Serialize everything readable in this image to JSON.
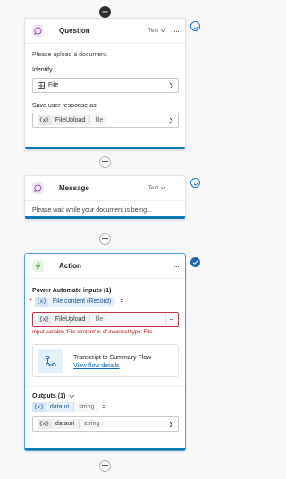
{
  "question": {
    "title": "Question",
    "type_label": "Text",
    "more": "···",
    "prompt": "Please upload a document.",
    "identify_label": "Identify",
    "identify_value": "File",
    "save_label": "Save user response as",
    "var_x": "{x}",
    "var_name": "FileUpload",
    "var_type": "file"
  },
  "message": {
    "title": "Message",
    "type_label": "Text",
    "more": "···",
    "text": "Please wait while your document is being..."
  },
  "action": {
    "title": "Action",
    "more": "···",
    "inputs_label": "Power Automate inputs (1)",
    "required_mark": "*",
    "input_x": "{x}",
    "input_name": "File content (Record)",
    "equals": "=",
    "value_x": "{x}",
    "value_name": "FileUpload",
    "value_type": "file",
    "value_more": "···",
    "error": "Input variable 'File content' is of incorrect type: File",
    "flow_title": "Transcript to Summary Flow",
    "flow_link": "View flow details",
    "outputs_label": "Outputs (1)",
    "out_x": "{x}",
    "out_name": "datauri",
    "out_type": "string",
    "out_equals": "=",
    "out_value_x": "{x}",
    "out_value_name": "datauri",
    "out_value_type": "string"
  },
  "connector": {
    "add": "+"
  },
  "colors": {
    "accent": "#0e7ab0",
    "check": "#1e67b0",
    "error": "#c4314b",
    "link": "#0f6cbd"
  },
  "icons": [
    "chat-bubble-icon",
    "chevron-down-icon",
    "more-icon",
    "check-circle-icon",
    "grid-icon",
    "chevron-right-icon",
    "lightning-icon",
    "flow-icon",
    "plus-icon"
  ]
}
